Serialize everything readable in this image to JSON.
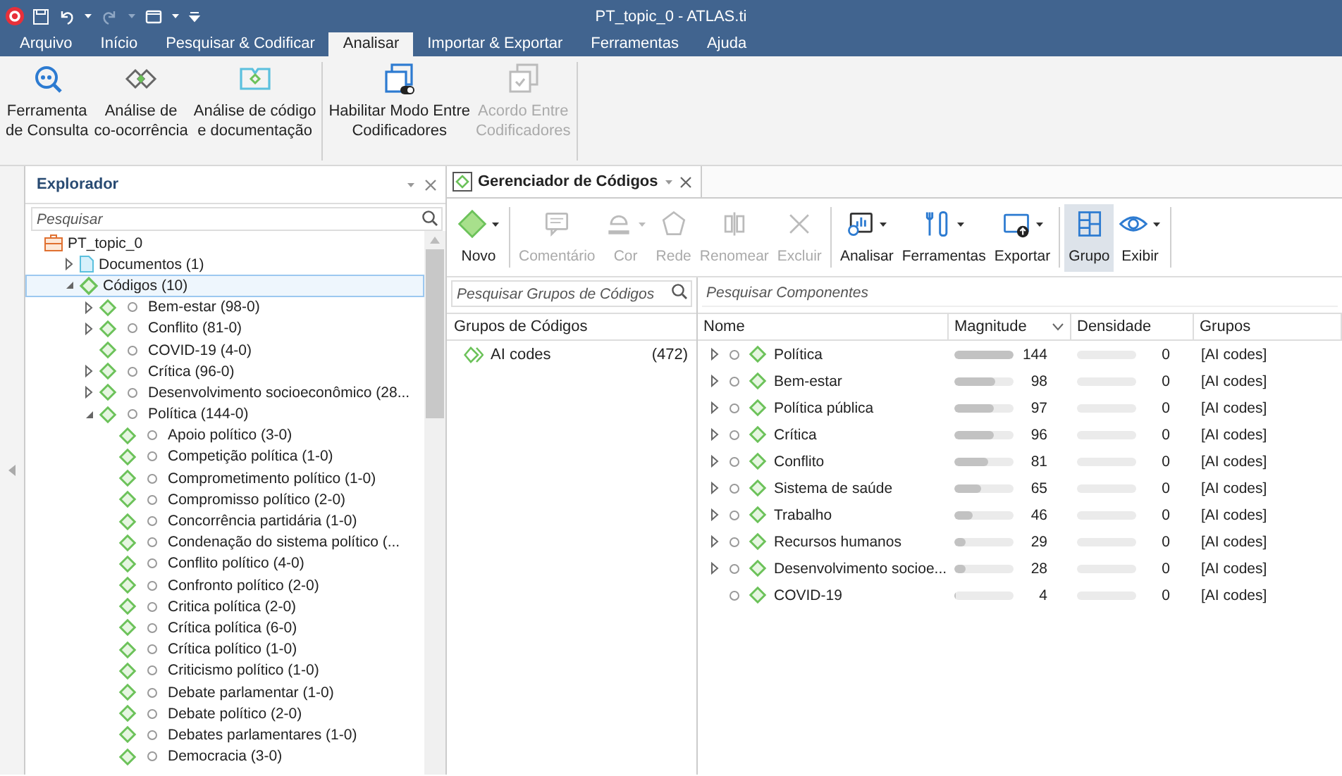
{
  "window": {
    "title": "PT_topic_0 - ATLAS.ti"
  },
  "menu_tabs": [
    {
      "label": "Arquivo",
      "selected": false
    },
    {
      "label": "Início",
      "selected": false
    },
    {
      "label": "Pesquisar & Codificar",
      "selected": false
    },
    {
      "label": "Analisar",
      "selected": true
    },
    {
      "label": "Importar & Exportar",
      "selected": false
    },
    {
      "label": "Ferramentas",
      "selected": false
    },
    {
      "label": "Ajuda",
      "selected": false
    }
  ],
  "ribbon": {
    "groups": [
      [
        {
          "label": "Ferramenta\nde Consulta",
          "disabled": false
        },
        {
          "label": "Análise de\nco-ocorrência",
          "disabled": false
        },
        {
          "label": "Análise de código\ne documentação",
          "disabled": false
        }
      ],
      [
        {
          "label": "Habilitar Modo Entre\nCodificadores",
          "disabled": false
        },
        {
          "label": "Acordo Entre\nCodificadores",
          "disabled": true
        }
      ]
    ]
  },
  "explorer": {
    "title": "Explorador",
    "search": {
      "placeholder": "Pesquisar"
    },
    "tree": [
      {
        "label": "PT_topic_0",
        "kind": "project",
        "selected": false,
        "children": [
          {
            "label": "Documentos (1)",
            "kind": "documents",
            "expandable": true,
            "expanded": false,
            "selected": false
          },
          {
            "label": "Códigos (10)",
            "kind": "codes",
            "expandable": true,
            "expanded": true,
            "selected": true,
            "children": [
              {
                "label": "Bem-estar (98-0)",
                "kind": "code",
                "expandable": true,
                "expanded": false,
                "selected": false
              },
              {
                "label": "Conflito (81-0)",
                "kind": "code",
                "expandable": true,
                "expanded": false,
                "selected": false
              },
              {
                "label": "COVID-19 (4-0)",
                "kind": "code",
                "expandable": false,
                "selected": false
              },
              {
                "label": "Crítica (96-0)",
                "kind": "code",
                "expandable": true,
                "expanded": false,
                "selected": false
              },
              {
                "label": "Desenvolvimento socioeconômico (28...",
                "kind": "code",
                "expandable": true,
                "expanded": false,
                "selected": false
              },
              {
                "label": "Política (144-0)",
                "kind": "code",
                "expandable": true,
                "expanded": true,
                "selected": false,
                "children": [
                  {
                    "label": "Apoio político (3-0)",
                    "kind": "code",
                    "expandable": false,
                    "selected": false
                  },
                  {
                    "label": "Competição política (1-0)",
                    "kind": "code",
                    "expandable": false,
                    "selected": false
                  },
                  {
                    "label": "Comprometimento político (1-0)",
                    "kind": "code",
                    "expandable": false,
                    "selected": false
                  },
                  {
                    "label": "Compromisso político (2-0)",
                    "kind": "code",
                    "expandable": false,
                    "selected": false
                  },
                  {
                    "label": "Concorrência partidária (1-0)",
                    "kind": "code",
                    "expandable": false,
                    "selected": false
                  },
                  {
                    "label": "Condenação do sistema político (...",
                    "kind": "code",
                    "expandable": false,
                    "selected": false
                  },
                  {
                    "label": "Conflito político (4-0)",
                    "kind": "code",
                    "expandable": false,
                    "selected": false
                  },
                  {
                    "label": "Confronto político (2-0)",
                    "kind": "code",
                    "expandable": false,
                    "selected": false
                  },
                  {
                    "label": "Critica política (2-0)",
                    "kind": "code",
                    "expandable": false,
                    "selected": false
                  },
                  {
                    "label": "Crítica política (6-0)",
                    "kind": "code",
                    "expandable": false,
                    "selected": false
                  },
                  {
                    "label": "Crítica político (1-0)",
                    "kind": "code",
                    "expandable": false,
                    "selected": false
                  },
                  {
                    "label": "Criticismo político (1-0)",
                    "kind": "code",
                    "expandable": false,
                    "selected": false
                  },
                  {
                    "label": "Debate parlamentar (1-0)",
                    "kind": "code",
                    "expandable": false,
                    "selected": false
                  },
                  {
                    "label": "Debate político (2-0)",
                    "kind": "code",
                    "expandable": false,
                    "selected": false
                  },
                  {
                    "label": "Debates parlamentares (1-0)",
                    "kind": "code",
                    "expandable": false,
                    "selected": false
                  },
                  {
                    "label": "Democracia (3-0)",
                    "kind": "code",
                    "expandable": false,
                    "selected": false
                  }
                ]
              }
            ]
          }
        ]
      }
    ]
  },
  "code_manager": {
    "tab": {
      "title": "Gerenciador de Códigos"
    },
    "toolbar": [
      {
        "label": "Novo",
        "disabled": false,
        "dropdown": true,
        "selected": false,
        "separator_after": true
      },
      {
        "label": "Comentário",
        "disabled": true,
        "dropdown": false,
        "selected": false,
        "separator_after": false
      },
      {
        "label": "Cor",
        "disabled": true,
        "dropdown": true,
        "selected": false,
        "separator_after": false
      },
      {
        "label": "Rede",
        "disabled": true,
        "dropdown": false,
        "selected": false,
        "separator_after": false
      },
      {
        "label": "Renomear",
        "disabled": true,
        "dropdown": false,
        "selected": false,
        "separator_after": false
      },
      {
        "label": "Excluir",
        "disabled": true,
        "dropdown": false,
        "selected": false,
        "separator_after": true
      },
      {
        "label": "Analisar",
        "disabled": false,
        "dropdown": true,
        "selected": false,
        "separator_after": false
      },
      {
        "label": "Ferramentas",
        "disabled": false,
        "dropdown": true,
        "selected": false,
        "separator_after": false
      },
      {
        "label": "Exportar",
        "disabled": false,
        "dropdown": true,
        "selected": false,
        "separator_after": true
      },
      {
        "label": "Grupo",
        "disabled": false,
        "dropdown": false,
        "selected": true,
        "separator_after": false
      },
      {
        "label": "Exibir",
        "disabled": false,
        "dropdown": true,
        "selected": false,
        "separator_after": true
      }
    ],
    "groups_search": {
      "placeholder": "Pesquisar Grupos de Códigos"
    },
    "groups_header": "Grupos de Códigos",
    "groups": [
      {
        "name": "AI codes",
        "count": "(472)"
      }
    ],
    "components_search": {
      "placeholder": "Pesquisar Componentes"
    },
    "table": {
      "columns": [
        "Nome",
        "Magnitude",
        "Densidade",
        "Grupos"
      ],
      "rows": [
        {
          "expandable": true,
          "name": "Política",
          "magnitude": {
            "value": "144",
            "level": 1.0
          },
          "density": {
            "value": "0",
            "level": 0
          },
          "groups": "[AI codes]"
        },
        {
          "expandable": true,
          "name": "Bem-estar",
          "magnitude": {
            "value": "98",
            "level": 0.68
          },
          "density": {
            "value": "0",
            "level": 0
          },
          "groups": "[AI codes]"
        },
        {
          "expandable": true,
          "name": "Política pública",
          "magnitude": {
            "value": "97",
            "level": 0.67
          },
          "density": {
            "value": "0",
            "level": 0
          },
          "groups": "[AI codes]"
        },
        {
          "expandable": true,
          "name": "Crítica",
          "magnitude": {
            "value": "96",
            "level": 0.67
          },
          "density": {
            "value": "0",
            "level": 0
          },
          "groups": "[AI codes]"
        },
        {
          "expandable": true,
          "name": "Conflito",
          "magnitude": {
            "value": "81",
            "level": 0.56
          },
          "density": {
            "value": "0",
            "level": 0
          },
          "groups": "[AI codes]"
        },
        {
          "expandable": true,
          "name": "Sistema de saúde",
          "magnitude": {
            "value": "65",
            "level": 0.45
          },
          "density": {
            "value": "0",
            "level": 0
          },
          "groups": "[AI codes]"
        },
        {
          "expandable": true,
          "name": "Trabalho",
          "magnitude": {
            "value": "46",
            "level": 0.32
          },
          "density": {
            "value": "0",
            "level": 0
          },
          "groups": "[AI codes]"
        },
        {
          "expandable": true,
          "name": "Recursos humanos",
          "magnitude": {
            "value": "29",
            "level": 0.2
          },
          "density": {
            "value": "0",
            "level": 0
          },
          "groups": "[AI codes]"
        },
        {
          "expandable": true,
          "name": "Desenvolvimento socioe...",
          "magnitude": {
            "value": "28",
            "level": 0.19
          },
          "density": {
            "value": "0",
            "level": 0
          },
          "groups": "[AI codes]"
        },
        {
          "expandable": false,
          "name": "COVID-19",
          "magnitude": {
            "value": "4",
            "level": 0.03
          },
          "density": {
            "value": "0",
            "level": 0
          },
          "groups": "[AI codes]"
        }
      ]
    }
  }
}
